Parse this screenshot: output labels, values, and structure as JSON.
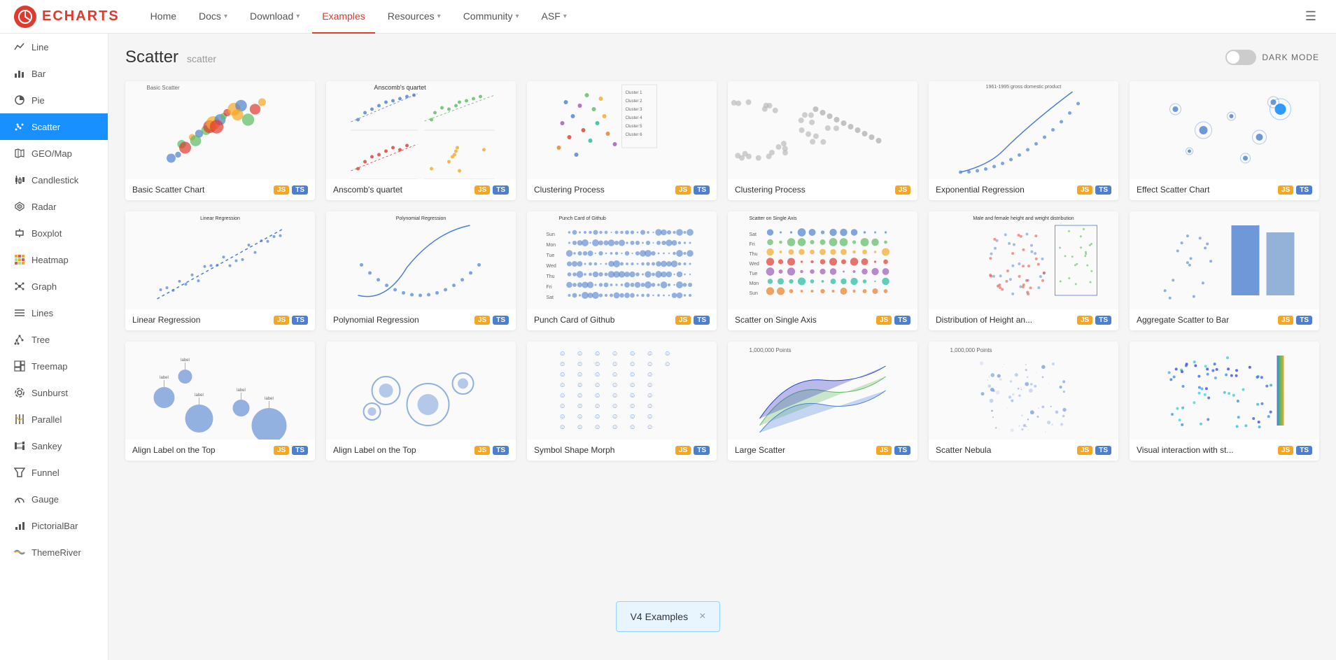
{
  "nav": {
    "logo": "ECHARTS",
    "items": [
      {
        "label": "Home",
        "hasArrow": false,
        "active": false
      },
      {
        "label": "Docs",
        "hasArrow": true,
        "active": false
      },
      {
        "label": "Download",
        "hasArrow": true,
        "active": false
      },
      {
        "label": "Examples",
        "hasArrow": false,
        "active": true
      },
      {
        "label": "Resources",
        "hasArrow": true,
        "active": false
      },
      {
        "label": "Community",
        "hasArrow": true,
        "active": false
      },
      {
        "label": "ASF",
        "hasArrow": true,
        "active": false
      }
    ]
  },
  "sidebar": {
    "items": [
      {
        "id": "line",
        "label": "Line",
        "icon": "line-icon"
      },
      {
        "id": "bar",
        "label": "Bar",
        "icon": "bar-icon"
      },
      {
        "id": "pie",
        "label": "Pie",
        "icon": "pie-icon"
      },
      {
        "id": "scatter",
        "label": "Scatter",
        "icon": "scatter-icon",
        "active": true
      },
      {
        "id": "geomap",
        "label": "GEO/Map",
        "icon": "map-icon"
      },
      {
        "id": "candlestick",
        "label": "Candlestick",
        "icon": "candlestick-icon"
      },
      {
        "id": "radar",
        "label": "Radar",
        "icon": "radar-icon"
      },
      {
        "id": "boxplot",
        "label": "Boxplot",
        "icon": "boxplot-icon"
      },
      {
        "id": "heatmap",
        "label": "Heatmap",
        "icon": "heatmap-icon"
      },
      {
        "id": "graph",
        "label": "Graph",
        "icon": "graph-icon"
      },
      {
        "id": "lines",
        "label": "Lines",
        "icon": "lines-icon"
      },
      {
        "id": "tree",
        "label": "Tree",
        "icon": "tree-icon"
      },
      {
        "id": "treemap",
        "label": "Treemap",
        "icon": "treemap-icon"
      },
      {
        "id": "sunburst",
        "label": "Sunburst",
        "icon": "sunburst-icon"
      },
      {
        "id": "parallel",
        "label": "Parallel",
        "icon": "parallel-icon"
      },
      {
        "id": "sankey",
        "label": "Sankey",
        "icon": "sankey-icon"
      },
      {
        "id": "funnel",
        "label": "Funnel",
        "icon": "funnel-icon"
      },
      {
        "id": "gauge",
        "label": "Gauge",
        "icon": "gauge-icon"
      },
      {
        "id": "pictorialbar",
        "label": "PictorialBar",
        "icon": "pictorialbar-icon"
      },
      {
        "id": "themeriver",
        "label": "ThemeRiver",
        "icon": "themeriver-icon"
      }
    ]
  },
  "page": {
    "title": "Scatter",
    "subtitle": "scatter",
    "darkModeLabel": "DARK MODE"
  },
  "charts": [
    {
      "name": "Basic Scatter Chart",
      "badges": [
        "JS",
        "TS"
      ],
      "type": "basic-scatter"
    },
    {
      "name": "Anscomb's quartet",
      "badges": [
        "JS",
        "TS"
      ],
      "type": "anscomb"
    },
    {
      "name": "Clustering Process",
      "badges": [
        "JS",
        "TS"
      ],
      "type": "clustering1"
    },
    {
      "name": "Clustering Process",
      "badges": [
        "JS"
      ],
      "type": "clustering2"
    },
    {
      "name": "Exponential Regression",
      "badges": [
        "JS",
        "TS"
      ],
      "type": "exponential"
    },
    {
      "name": "Effect Scatter Chart",
      "badges": [
        "JS",
        "TS"
      ],
      "type": "effect-scatter"
    },
    {
      "name": "Linear Regression",
      "badges": [
        "JS",
        "TS"
      ],
      "type": "linear-regression"
    },
    {
      "name": "Polynomial Regression",
      "badges": [
        "JS",
        "TS"
      ],
      "type": "polynomial"
    },
    {
      "name": "Punch Card of Github",
      "badges": [
        "JS",
        "TS"
      ],
      "type": "punch-card"
    },
    {
      "name": "Scatter on Single Axis",
      "badges": [
        "JS",
        "TS"
      ],
      "type": "single-axis"
    },
    {
      "name": "Distribution of Height an...",
      "badges": [
        "JS",
        "TS"
      ],
      "type": "height-dist"
    },
    {
      "name": "Aggregate Scatter to Bar",
      "badges": [
        "JS",
        "TS"
      ],
      "type": "scatter-to-bar"
    },
    {
      "name": "Align Label on the Top",
      "badges": [
        "JS",
        "TS"
      ],
      "type": "align-label1"
    },
    {
      "name": "Align Label on the Top",
      "badges": [
        "JS",
        "TS"
      ],
      "type": "align-label2"
    },
    {
      "name": "Symbol Shape Morph",
      "badges": [
        "JS",
        "TS"
      ],
      "type": "symbol-morph"
    },
    {
      "name": "Large Scatter",
      "badges": [
        "JS",
        "TS"
      ],
      "type": "large-scatter"
    },
    {
      "name": "Scatter Nebula",
      "badges": [
        "JS",
        "TS"
      ],
      "type": "nebula"
    },
    {
      "name": "Visual interaction with st...",
      "badges": [
        "JS",
        "TS"
      ],
      "type": "visual-interaction"
    }
  ],
  "v4banner": {
    "label": "V4 Examples",
    "closeIcon": "×"
  }
}
